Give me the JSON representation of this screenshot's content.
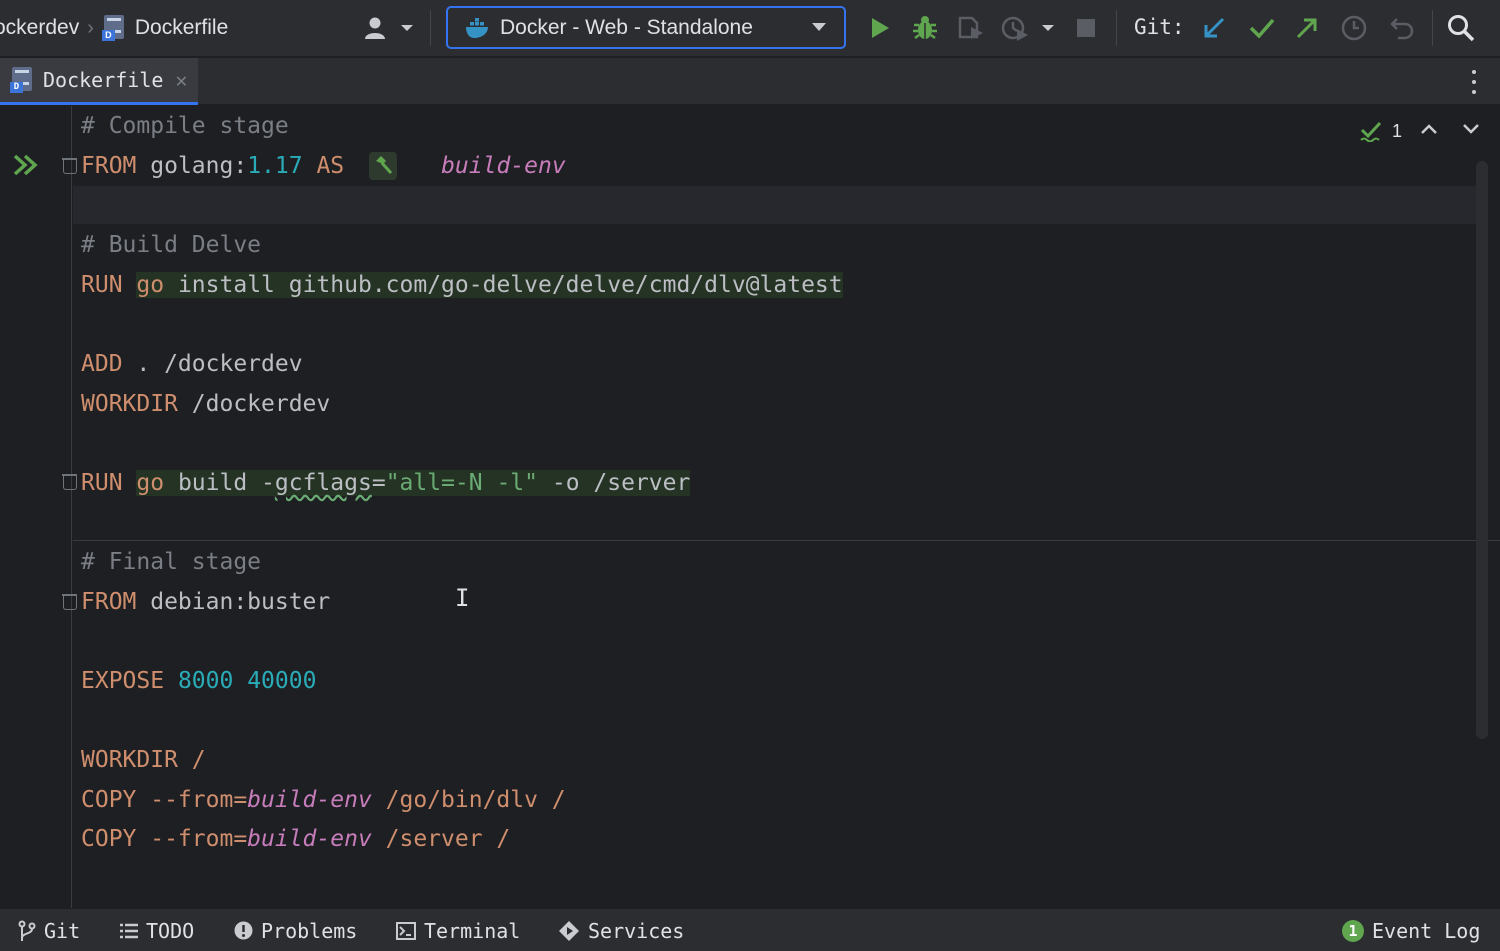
{
  "toolbar": {
    "breadcrumb": {
      "project": "ockerdev",
      "file": "Dockerfile"
    },
    "run_config": {
      "label": "Docker - Web - Standalone",
      "icon": "docker-whale-icon"
    },
    "git_label": "Git:",
    "icons": [
      "user-icon",
      "run-icon",
      "debug-icon",
      "coverage-icon",
      "profile-icon",
      "stop-icon",
      "git-update-icon",
      "git-commit-icon",
      "git-push-icon",
      "history-icon",
      "rollback-icon",
      "search-icon"
    ],
    "colors": {
      "accent": "#3574f0",
      "run_green": "#5fa64f",
      "git_blue": "#3592c4"
    }
  },
  "tabs": [
    {
      "label": "Dockerfile",
      "active": true
    }
  ],
  "editor": {
    "inspections_count": "1",
    "lines": {
      "l1": "# Compile stage",
      "l2_from": "FROM",
      "l2_image": "golang:",
      "l2_version": "1.17",
      "l2_as": "AS",
      "l2_stage": "build-env",
      "l4": "# Build Delve",
      "l5_run": "RUN",
      "l5_go": "go",
      "l5_rest": " install github.com/go-delve/delve/cmd/dlv@latest",
      "l7_add": "ADD",
      "l7_rest": " . /dockerdev",
      "l8_workdir": "WORKDIR",
      "l8_rest": " /dockerdev",
      "l10_run": "RUN",
      "l10_go": "go",
      "l10_build": " build -",
      "l10_flag": "gcflags",
      "l10_eq": "=",
      "l10_str": "\"all=-N -l\"",
      "l10_rest": " -o /server",
      "l12": "# Final stage",
      "l13_from": "FROM",
      "l13_rest": " debian:buster",
      "l15_expose": "EXPOSE",
      "l15_p1": "8000",
      "l15_p2": "40000",
      "l17_workdir": "WORKDIR",
      "l17_rest": " /",
      "l18_copy": "COPY",
      "l18_flag": " --from=",
      "l18_stage": "build-env",
      "l18_rest": " /go/bin/dlv /",
      "l19_copy": "COPY",
      "l19_flag": " --from=",
      "l19_stage": "build-env",
      "l19_rest": " /server /"
    }
  },
  "statusbar": {
    "git": "Git",
    "todo": "TODO",
    "problems": "Problems",
    "terminal": "Terminal",
    "services": "Services",
    "event_log_count": "1",
    "event_log": "Event Log"
  }
}
